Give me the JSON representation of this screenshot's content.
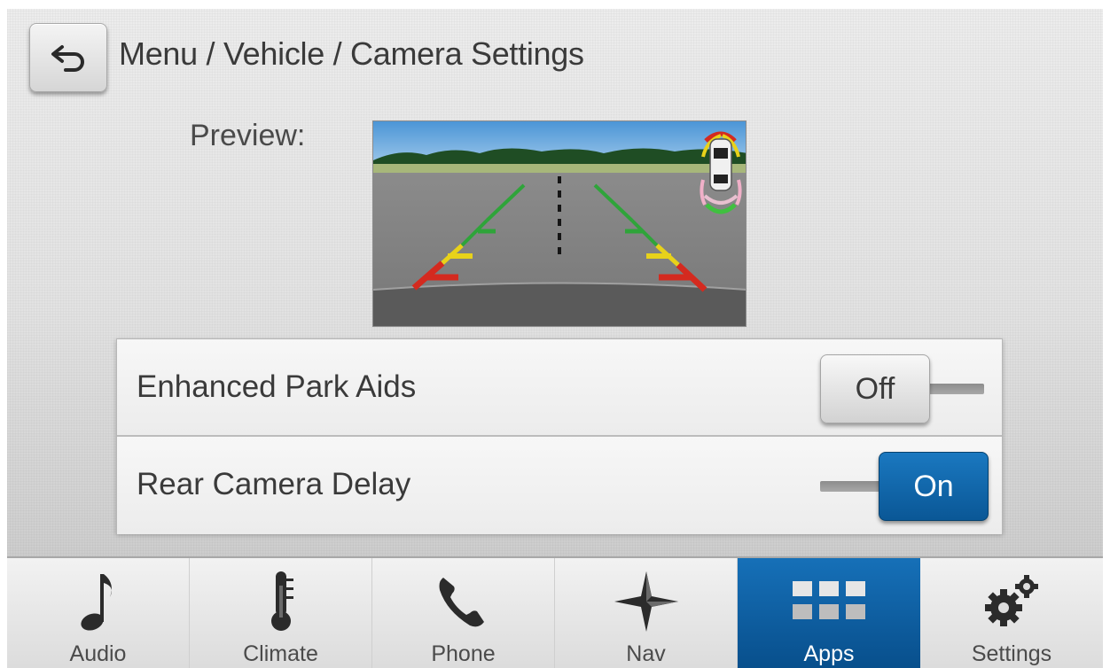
{
  "header": {
    "back_icon": "back-arrow-icon",
    "breadcrumb": "Menu / Vehicle / Camera Settings"
  },
  "preview": {
    "label": "Preview:"
  },
  "settings": [
    {
      "label": "Enhanced Park Aids",
      "state": "Off"
    },
    {
      "label": "Rear Camera Delay",
      "state": "On"
    }
  ],
  "nav": [
    {
      "label": "Audio",
      "icon": "music-note-icon",
      "active": false
    },
    {
      "label": "Climate",
      "icon": "thermometer-icon",
      "active": false
    },
    {
      "label": "Phone",
      "icon": "phone-icon",
      "active": false
    },
    {
      "label": "Nav",
      "icon": "compass-star-icon",
      "active": false
    },
    {
      "label": "Apps",
      "icon": "apps-grid-icon",
      "active": true
    },
    {
      "label": "Settings",
      "icon": "gears-icon",
      "active": false
    }
  ],
  "colors": {
    "accent": "#0a5796",
    "guide_green": "#2fa43a",
    "guide_yellow": "#e8d21a",
    "guide_red": "#d42a1f"
  }
}
